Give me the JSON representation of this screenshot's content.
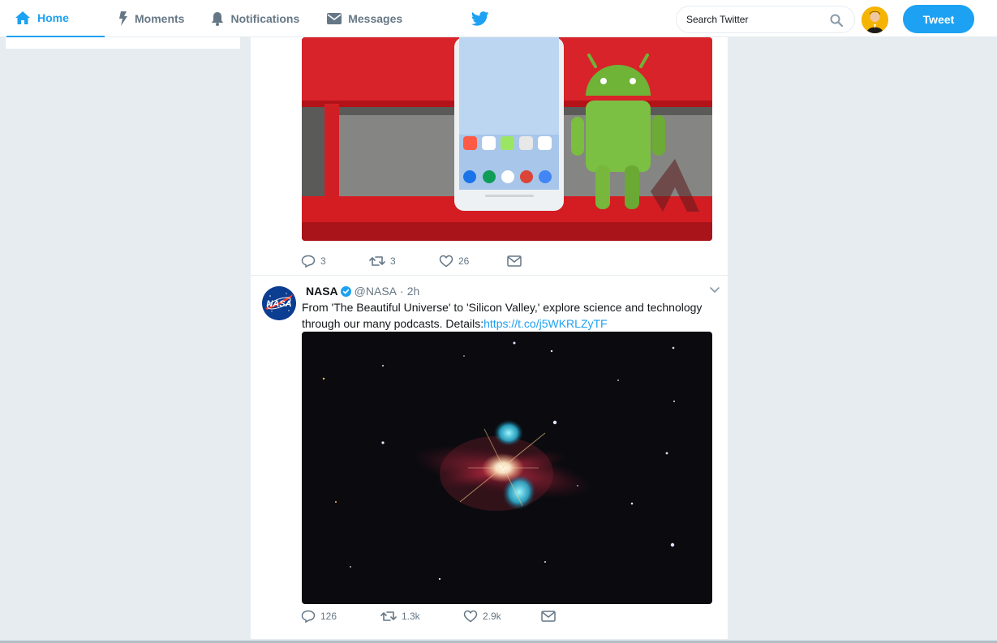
{
  "nav": {
    "home": "Home",
    "moments": "Moments",
    "notifications": "Notifications",
    "messages": "Messages"
  },
  "search": {
    "placeholder": "Search Twitter"
  },
  "tweet_button": "Tweet",
  "colors": {
    "accent": "#1da1f2",
    "background": "#e6ecf0",
    "muted": "#657786"
  },
  "tweets": [
    {
      "stats": {
        "replies": "3",
        "retweets": "3",
        "likes": "26"
      }
    },
    {
      "name": "NASA",
      "handle": "@NASA",
      "separator": "·",
      "time": "2h",
      "text": "From 'The Beautiful Universe' to 'Silicon Valley,' explore science and technology through our many podcasts. Details:",
      "link": "https://t.co/j5WKRLZyTF",
      "stats": {
        "replies": "126",
        "retweets": "1.3k",
        "likes": "2.9k"
      }
    }
  ]
}
